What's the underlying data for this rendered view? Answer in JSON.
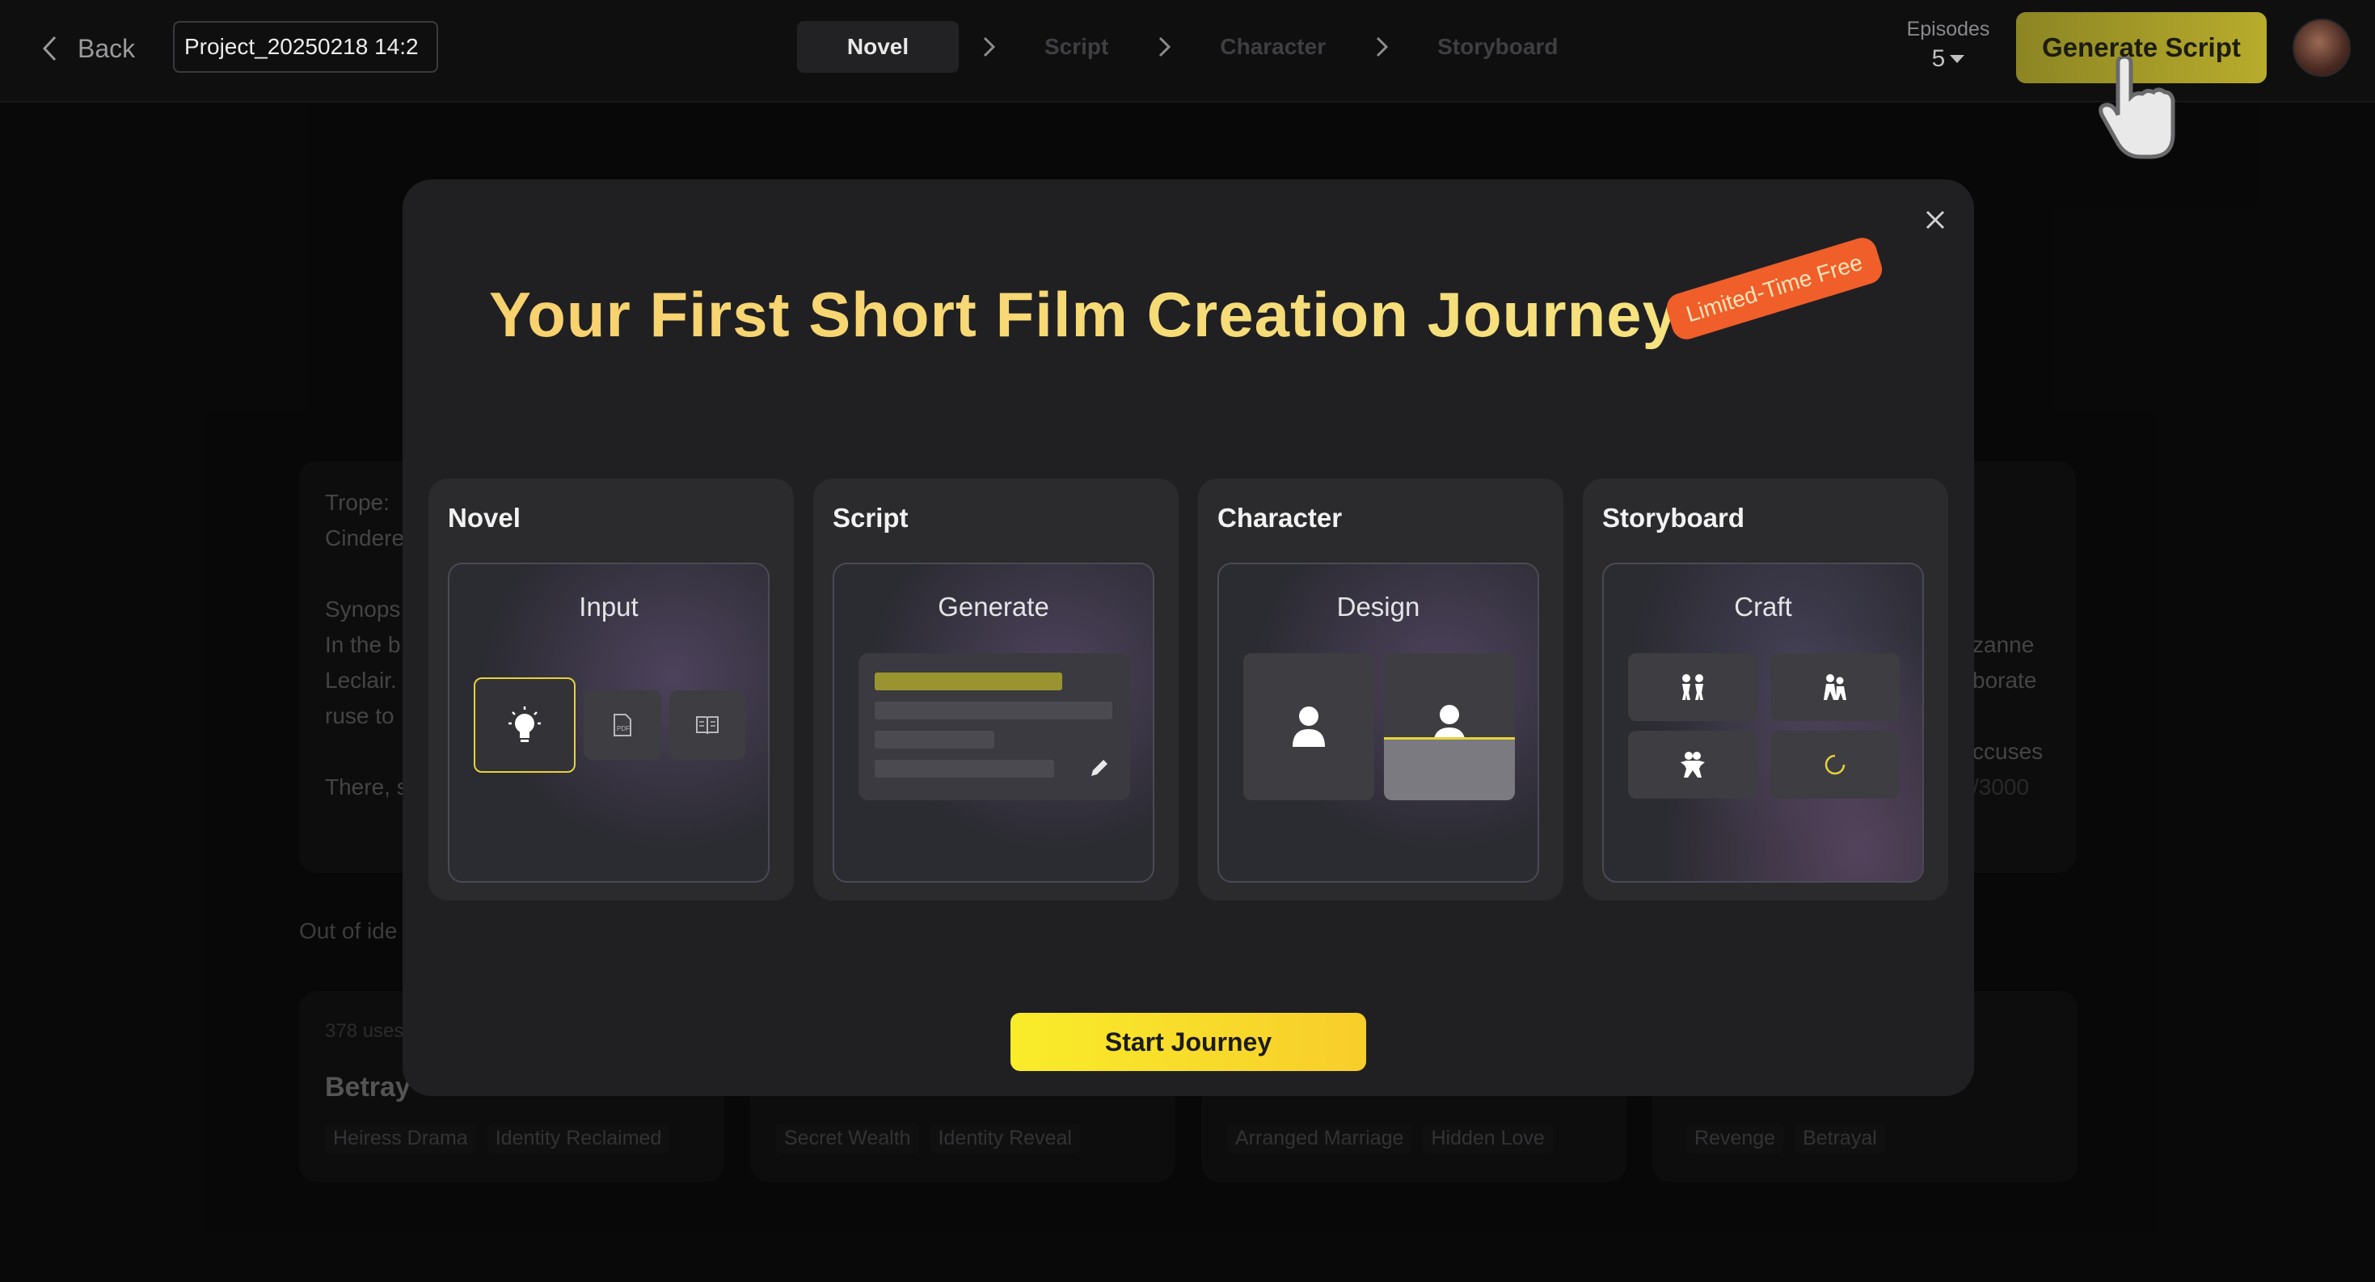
{
  "header": {
    "back_label": "Back",
    "project_name": "Project_20250218 14:2",
    "steps": [
      "Novel",
      "Script",
      "Character",
      "Storyboard"
    ],
    "episodes_label": "Episodes",
    "episodes_value": "5",
    "generate_button": "Generate Script"
  },
  "background": {
    "left_card_lines": [
      "Trope:",
      "Cindere",
      "",
      "Synops",
      "In the b",
      "Leclair.",
      "ruse to",
      "",
      "There, s"
    ],
    "right_card_lines": [
      "zanne",
      "borate",
      "",
      "ccuses"
    ],
    "char_count": "/3000",
    "out_of_ideas": "Out of ide",
    "first_card_uses": "378 uses",
    "first_card_title": "Betray",
    "tag_groups": [
      [
        "Heiress Drama",
        "Identity Reclaimed"
      ],
      [
        "Secret Wealth",
        "Identity Reveal"
      ],
      [
        "Arranged Marriage",
        "Hidden Love"
      ],
      [
        "Revenge",
        "Betrayal"
      ]
    ]
  },
  "modal": {
    "title": "Your First Short Film Creation Journey",
    "badge": "Limited-Time Free",
    "cards": [
      {
        "title": "Novel",
        "label": "Input"
      },
      {
        "title": "Script",
        "label": "Generate"
      },
      {
        "title": "Character",
        "label": "Design"
      },
      {
        "title": "Storyboard",
        "label": "Craft"
      }
    ],
    "start_button": "Start Journey"
  },
  "colors": {
    "accent_yellow": "#f2d15d",
    "badge_orange": "#f05e2a",
    "generate_button": "#b0a62a"
  }
}
